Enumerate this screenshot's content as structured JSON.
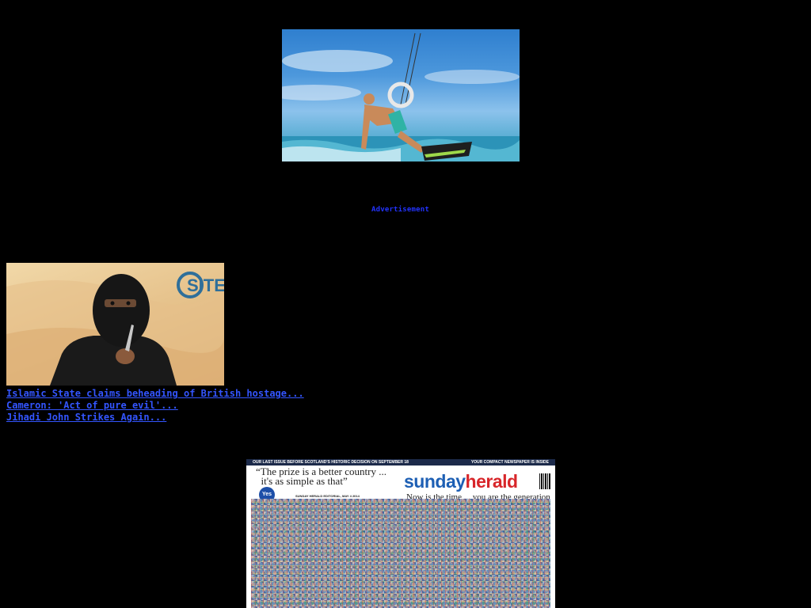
{
  "ad": {
    "label": "Advertisement"
  },
  "headlines": {
    "items": [
      "Islamic State claims beheading of British hostage...",
      "Cameron: 'Act of pure evil'...",
      "Jihadi John Strikes Again..."
    ]
  },
  "newspaper": {
    "topbar_left": "OUR LAST ISSUE BEFORE SCOTLAND'S HISTORIC DECISION ON SEPTEMBER 18",
    "topbar_right": "YOUR COMPACT NEWSPAPER IS INSIDE",
    "quote": "“The prize is a better country ...\n  it's as simple as that”",
    "yes_badge": "Yes",
    "editorial": "SUNDAY HERALD EDITORIAL, MAY 4 2014",
    "masthead_part1": "sunday",
    "masthead_part2": "herald",
    "tagline": "Now is the time ... you are the generation"
  },
  "colors": {
    "background": "#000000",
    "link": "#3355ff",
    "ad_label": "#2233ff"
  }
}
